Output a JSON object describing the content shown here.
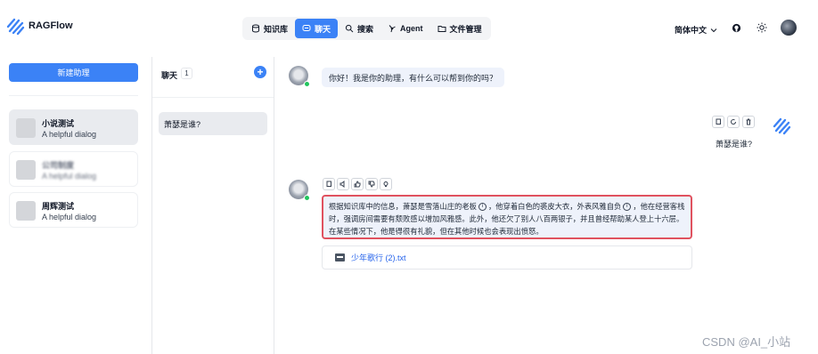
{
  "app": {
    "title": "RAGFlow"
  },
  "nav": [
    {
      "label": "知识库",
      "icon": "database-icon"
    },
    {
      "label": "聊天",
      "icon": "chat-icon",
      "active": true
    },
    {
      "label": "搜索",
      "icon": "search-icon"
    },
    {
      "label": "Agent",
      "icon": "agent-icon"
    },
    {
      "label": "文件管理",
      "icon": "folder-icon"
    }
  ],
  "header": {
    "language": "简体中文",
    "icons": [
      "github-icon",
      "sun-icon",
      "user-avatar"
    ]
  },
  "sidebar": {
    "new_button": "新建助理",
    "dialogs": [
      {
        "name": "小说测试",
        "description": "A helpful dialog",
        "active": true
      },
      {
        "name": "公司制度",
        "description": "A helpful dialog",
        "blurred": true
      },
      {
        "name": "周辉测试",
        "description": "A helpful dialog"
      }
    ]
  },
  "conversations": {
    "title": "聊天",
    "count": "1",
    "items": [
      {
        "label": "萧瑟是谁?"
      }
    ]
  },
  "chat": {
    "greeting": "你好！我是你的助理，有什么可以帮到你的吗？",
    "user_message": "萧瑟是谁?",
    "answer": {
      "part1": "根据知识库中的信息，萧瑟是雪落山庄的老板",
      "part2": "，他穿着白色的裘皮大衣，外表风雅自负",
      "part3": "，他在经营客栈时，强调房间需要有颓败感以增加风雅感。此外，他还欠了别人八百两银子，并且曾经帮助某人登上十六层。在某些情况下，他是得很有礼貌，但在其他时候也会表现出愤怒。",
      "citation_marker": "i"
    },
    "source_file": "少年歌行 (2).txt"
  },
  "watermark": "CSDN @AI_小站",
  "colors": {
    "accent": "#3b82f6",
    "highlight_border": "#e0525f",
    "bubble": "#eef2fb",
    "online": "#22c55e"
  }
}
